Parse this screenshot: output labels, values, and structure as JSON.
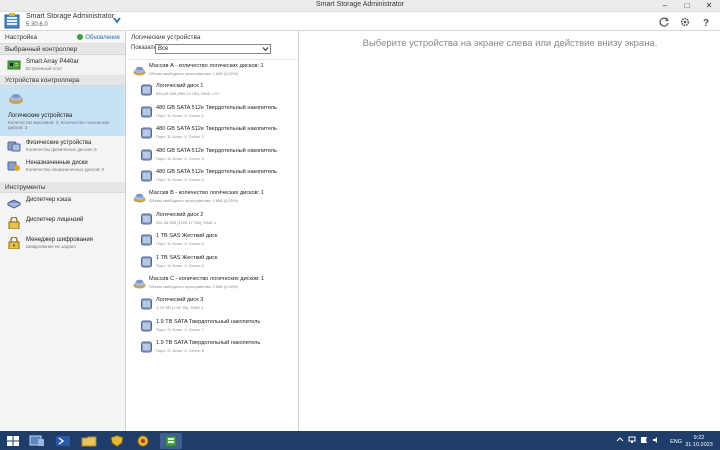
{
  "window": {
    "title": "Smart Storage Administrator"
  },
  "app": {
    "name": "Smart Storage Administrator",
    "version": "5.30.6.0"
  },
  "left": {
    "settings_label": "Настройка",
    "refresh_label": "Обновление",
    "selected_controller_header": "Выбранный контроллер",
    "controller": {
      "name": "Smart Array P440ar",
      "sub": "Встроенный слот"
    },
    "controller_devices_header": "Устройства контроллера",
    "logical": {
      "name": "Логические устройства",
      "sub": "Количество массивов: 3; Количество логических дисков: 3"
    },
    "physical": {
      "name": "Физические устройства",
      "sub": "Количество физических дисков: 8"
    },
    "unassigned": {
      "name": "Неназначенные диски",
      "sub": "Количество неназначенных дисков: 0"
    },
    "tools_header": "Инструменты",
    "tools": [
      {
        "name": "Диспетчер кэша",
        "sub": ""
      },
      {
        "name": "Диспетчер лицензий",
        "sub": ""
      },
      {
        "name": "Менеджер шифрования",
        "sub": "Шифрование не задано"
      }
    ]
  },
  "middle": {
    "title": "Логические устройства",
    "show_label": "Показать",
    "filter_value": "Все",
    "rows": [
      {
        "kind": "array",
        "t1": "Массив A - количество логических дисков: 1",
        "t2": "Объем свободного пространства: 1 MiB (0,00%)"
      },
      {
        "kind": "logical",
        "t1": "Логический диск 1",
        "t2": "894,20 GiB (960,14 GB), RAID 1+0"
      },
      {
        "kind": "ssd",
        "t1": "480 GB SATA 512e Твердотельный накопитель",
        "t2": "Порт: 1I: Блок: 1: Отсек: 1"
      },
      {
        "kind": "ssd",
        "t1": "480 GB SATA 512e Твердотельный накопитель",
        "t2": "Порт: 1I: Блок: 1: Отсек: 2"
      },
      {
        "kind": "ssd",
        "t1": "480 GB SATA 512e Твердотельный накопитель",
        "t2": "Порт: 1I: Блок: 1: Отсек: 3"
      },
      {
        "kind": "ssd",
        "t1": "480 GB SATA 512e Твердотельный накопитель",
        "t2": "Порт: 1I: Блок: 1: Отсек: 4"
      },
      {
        "kind": "array",
        "t1": "Массив B - количество логических дисков: 1",
        "t2": "Объем свободного пространства: 0 MiB (0,00%)"
      },
      {
        "kind": "logical",
        "t1": "Логический диск 2",
        "t2": "931,48 GiB (1000,17 GB), RAID 1"
      },
      {
        "kind": "hdd",
        "t1": "1 TB SAS Жесткий диск",
        "t2": "Порт: 1I: Блок: 1: Отсек: 5"
      },
      {
        "kind": "hdd",
        "t1": "1 TB SAS Жесткий диск",
        "t2": "Порт: 1I: Блок: 1: Отсек: 6"
      },
      {
        "kind": "array",
        "t1": "Массив C - количество логических дисков: 1",
        "t2": "Объем свободного пространства: 0 MiB (0,00%)"
      },
      {
        "kind": "logical",
        "t1": "Логический диск 3",
        "t2": "1,75 TiB (1,92 TB), RAID 1"
      },
      {
        "kind": "ssd",
        "t1": "1.9 TB SATA Твердотельный накопитель",
        "t2": "Порт: 2I: Блок: 1: Отсек: 7"
      },
      {
        "kind": "ssd",
        "t1": "1.9 TB SATA Твердотельный накопитель",
        "t2": "Порт: 2I: Блок: 1: Отсек: 8"
      }
    ]
  },
  "right": {
    "message": "Выберите устройства на экране слева или действие внизу экрана."
  },
  "taskbar": {
    "lang": "ENG",
    "time": "9:22",
    "date": "31.10.2023"
  },
  "colors": {
    "selected": "#c7e1f5",
    "taskbar": "#1f3d6b",
    "accent": "#2a6fb3"
  }
}
